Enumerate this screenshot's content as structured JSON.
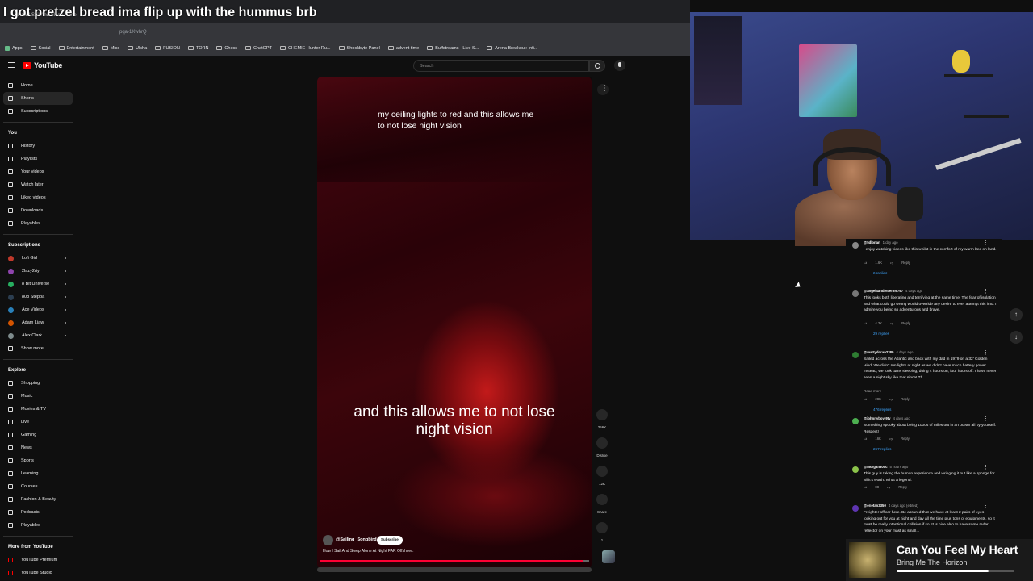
{
  "chat": {
    "username": "",
    "message": "I got pretzel bread ima flip up with the hummus brb"
  },
  "browser": {
    "tab_title": "How I Sail And Sleep Alone",
    "url_fragment": "pqa-1XwhrQ",
    "bookmarks": [
      "Apps",
      "Social",
      "Entertainment",
      "Misc",
      "Ulsha",
      "FUSION",
      "TORN",
      "Chess",
      "ChatGPT",
      "CHEMIE Hunter Ru...",
      "Shockbyte Panel",
      "advent time",
      "Buffstreams - Live S...",
      "Arena Breakout: Infi..."
    ]
  },
  "youtube": {
    "logo_text": "YouTube",
    "search_placeholder": "Search"
  },
  "sidebar": {
    "main": [
      "Home",
      "Shorts",
      "Subscriptions"
    ],
    "you_header": "You",
    "you_items": [
      "History",
      "Playlists",
      "Your videos",
      "Watch later",
      "Liked videos",
      "Downloads",
      "Playables"
    ],
    "subs_header": "Subscriptions",
    "subs": [
      {
        "name": "Lofi Girl",
        "color": "#c0392b"
      },
      {
        "name": "2lazy2riy",
        "color": "#8e44ad"
      },
      {
        "name": "8 Bit Universe",
        "color": "#27ae60"
      },
      {
        "name": "808 Steppa",
        "color": "#2c3e50"
      },
      {
        "name": "Ace Videos",
        "color": "#2980b9"
      },
      {
        "name": "Adam Liaw",
        "color": "#d35400"
      },
      {
        "name": "Alex Clark",
        "color": "#7f8c8d"
      }
    ],
    "show_more": "Show more",
    "explore_header": "Explore",
    "explore": [
      "Shopping",
      "Music",
      "Movies & TV",
      "Live",
      "Gaming",
      "News",
      "Sports",
      "Learning",
      "Courses",
      "Fashion & Beauty",
      "Podcasts",
      "Playables"
    ],
    "more_header": "More from YouTube",
    "more": [
      "YouTube Premium",
      "YouTube Studio"
    ]
  },
  "video": {
    "caption_top": "my ceiling lights to red and this allows me to not lose night vision",
    "caption_main": "and this allows me to not lose night vision",
    "channel": "@Sailing_Songbird",
    "subscribe_label": "Subscribe",
    "title": "How I Sail And Sleep Alone At Night FAR Offshore.",
    "progress": 0.98
  },
  "actions": {
    "like_count": "256K",
    "dislike_label": "Dislike",
    "comment_count": "12K",
    "share_label": "Share",
    "remix_count": "1"
  },
  "comments": [
    {
      "user": "@5dlonan",
      "time": "1 day ago",
      "text": "I enjoy watching videos like this whilst in the comfort of my warm bed on land.",
      "likes": "1.6K",
      "reply": "Reply",
      "replies": "6 replies",
      "color": "#888888"
    },
    {
      "user": "@angelaandreaenn6797",
      "time": "4 days ago",
      "text": "This looks both liberating and terrifying at the same time. The fear of isolation and what could go wrong would override any desire to ever attempt this imo. I admire you being so adventurous and brave.",
      "likes": "4.3K",
      "reply": "Reply",
      "replies": "29 replies",
      "color": "#777777"
    },
    {
      "user": "@martydoran2389",
      "time": "4 days ago",
      "text": "Sailed across the Atlantic and back with my dad in 1979 on a 32' Golden Hind. We didn't run lights at night as we didn't have much battery power. Instead, we took turns sleeping, doing 4 hours on, four hours off. I have never seen a night sky like that since! Th...",
      "readmore": "Read more",
      "likes": "28K",
      "reply": "Reply",
      "replies": "476 replies",
      "color": "#2e7d32"
    },
    {
      "user": "@johnnyboy-9tv",
      "time": "4 days ago",
      "text": "Something spooky about being 1000s of miles out in an ocean all by yourself. Respect!",
      "likes": "16K",
      "reply": "Reply",
      "replies": "267 replies",
      "color": "#4caf50"
    },
    {
      "user": "@morgan300c",
      "time": "5 hours ago",
      "text": "This guy is taking the human experience and wringing it out like a sponge for all it's worth.  What a legend.",
      "likes": "88",
      "reply": "Reply",
      "replies": "",
      "color": "#8bc34a"
    },
    {
      "user": "@eriefan3350",
      "time": "4 days ago (edited)",
      "text": "Freighter officer here. Be assured that we have at least 2 pairs of eyes looking out for you at night and day all the time plus tons of equipments, so it must be really intentional collision if so. It is nice also to have some radar reflector on your mast as small...",
      "likes": "",
      "reply": "",
      "replies": "",
      "color": "#5e35b1"
    }
  ],
  "now_playing": {
    "title": "Can You Feel My Heart",
    "artist": "Bring Me The Horizon",
    "progress": 0.78
  }
}
